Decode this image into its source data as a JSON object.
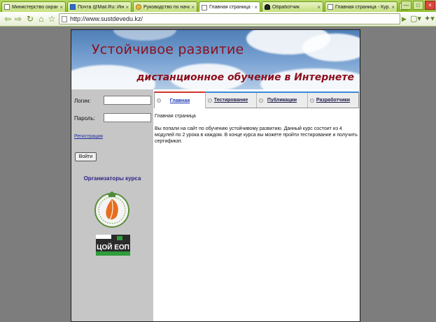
{
  "browser": {
    "tabs": [
      {
        "label": "Министерство охраны о...",
        "icon": "page-icon",
        "active": false
      },
      {
        "label": "Почта @Mail.Ru: Информ...",
        "icon": "mail-icon",
        "active": false
      },
      {
        "label": "Руководство по началу ...",
        "icon": "globe-icon",
        "active": false
      },
      {
        "label": "Главная страница - Кур...",
        "icon": "page-icon",
        "active": true
      },
      {
        "label": "Обработчик",
        "icon": "spy-icon",
        "active": false
      },
      {
        "label": "Главная страница - Кур...",
        "icon": "page-icon",
        "active": false
      }
    ],
    "close_glyph": "×",
    "newtab_glyph": "+",
    "window_controls": {
      "minimize": "—",
      "maximize": "□",
      "close": "×"
    },
    "address": "http://www.sustdevedu.kz/",
    "nav": {
      "back": "⇦",
      "forward": "⇨",
      "reload": "↻",
      "home": "⌂",
      "star": "☆"
    },
    "go_glyph": "▶",
    "page_menu_glyph": "▢▾",
    "tools_menu_glyph": "✦▾"
  },
  "site": {
    "banner": {
      "title": "Устойчивое развитие",
      "subtitle": "дистанционное обучение в Интернете"
    },
    "sidebar": {
      "login_label": "Логин:",
      "login_value": "",
      "password_label": "Пароль:",
      "password_value": "",
      "register_link": "Регистрация",
      "login_button": "Войти",
      "organizers_title": "Организаторы курса",
      "logo2_text": "ЦОЙ ЕОП"
    },
    "nav_tabs": [
      {
        "label": "Главная",
        "active": true
      },
      {
        "label": "Тестирование",
        "active": false
      },
      {
        "label": "Публикации",
        "active": false
      },
      {
        "label": "Разработчики",
        "active": false
      }
    ],
    "content": {
      "heading": "Главная страница",
      "body": "Вы попали на сайт по обучению устойчивому развитию. Данный курс состоит из 4 модулей по 2 урока в каждом. В конце курса вы можете пройти тестирование и получить сертификат."
    }
  },
  "colors": {
    "chrome_green": "#8fbe2d",
    "banner_text": "#8c0f1d",
    "sidebar_bg": "#c6c6c6",
    "organizers_text": "#2a1f86",
    "active_tab_accent": "#d2342a",
    "tabs_border": "#3a8ad8"
  }
}
